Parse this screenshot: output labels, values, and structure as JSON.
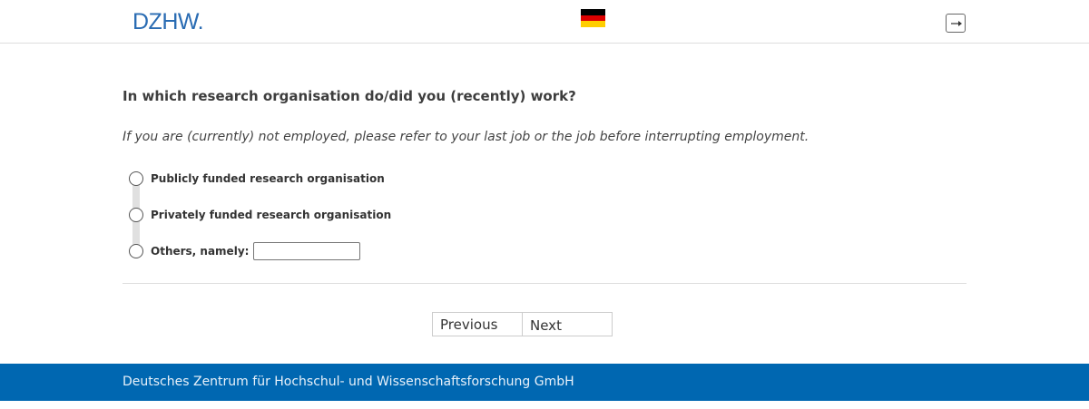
{
  "header": {
    "logo_text": "DZHW.",
    "language_flag_icon": "germany-flag-icon",
    "logout_icon": "logout-icon"
  },
  "question": {
    "title": "In which research organisation do/did you (recently) work?",
    "instruction": "If you are (currently) not employed, please refer to your last job or the job before interrupting employment.",
    "options": [
      {
        "label": "Publicly funded research organisation",
        "selected": false
      },
      {
        "label": "Privately funded research organisation",
        "selected": false
      },
      {
        "label": "Others, namely:",
        "selected": false,
        "input_value": ""
      }
    ]
  },
  "navigation": {
    "previous_label": "Previous",
    "next_label": "Next"
  },
  "footer": {
    "text": "Deutsches Zentrum für Hochschul- und Wissenschaftsforschung GmbH"
  },
  "colors": {
    "brand_blue": "#0067b1",
    "logo_blue": "#2a6cb3"
  }
}
